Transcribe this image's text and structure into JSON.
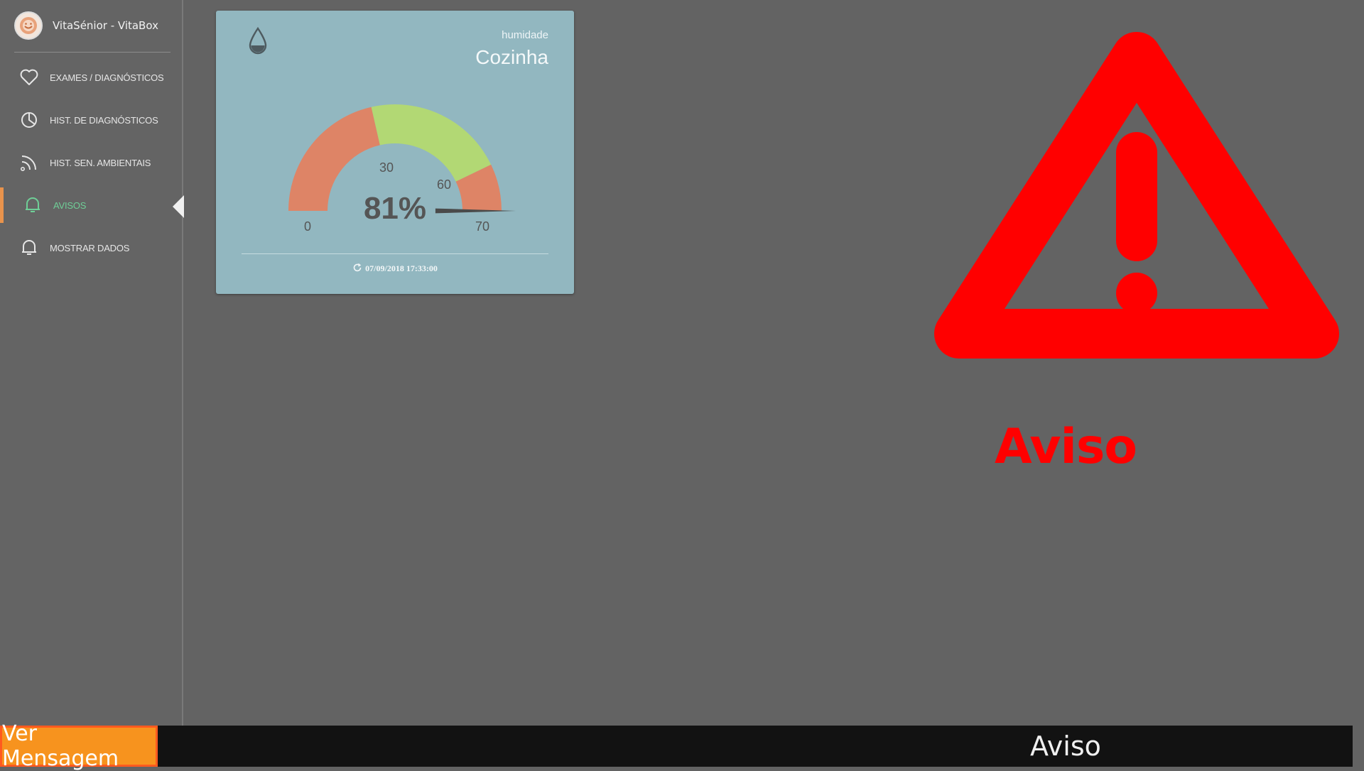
{
  "brand": {
    "title": "VitaSénior - VitaBox"
  },
  "sidebar": {
    "items": [
      {
        "label": "EXAMES / DIAGNÓSTICOS",
        "icon": "heart-icon"
      },
      {
        "label": "HIST. DE DIAGNÓSTICOS",
        "icon": "pie-chart-icon"
      },
      {
        "label": "HIST. SEN. AMBIENTAIS",
        "icon": "rss-icon"
      },
      {
        "label": "AVISOS",
        "icon": "bell-icon",
        "active": true
      },
      {
        "label": "MOSTRAR DADOS",
        "icon": "bell-icon"
      }
    ]
  },
  "card": {
    "category": "humidade",
    "room": "Cozinha",
    "icon": "water-drop-icon",
    "gauge": {
      "value": 81,
      "value_label": "81%",
      "min": 0,
      "max": 70,
      "low_threshold": 30,
      "high_threshold": 60,
      "tick_labels": {
        "min": "0",
        "low": "30",
        "high": "60",
        "max": "70"
      },
      "colors": {
        "bad": "#de8466",
        "good": "#b2d874",
        "needle": "#4a4a4a"
      }
    },
    "timestamp": "07/09/2018  17:33:00"
  },
  "warning": {
    "title": "Aviso",
    "icon": "warning-triangle-icon",
    "color": "#ff0000"
  },
  "bottom_bar": {
    "button_label": "Ver Mensagem",
    "title": "Aviso",
    "button_color": "#f7931e"
  }
}
